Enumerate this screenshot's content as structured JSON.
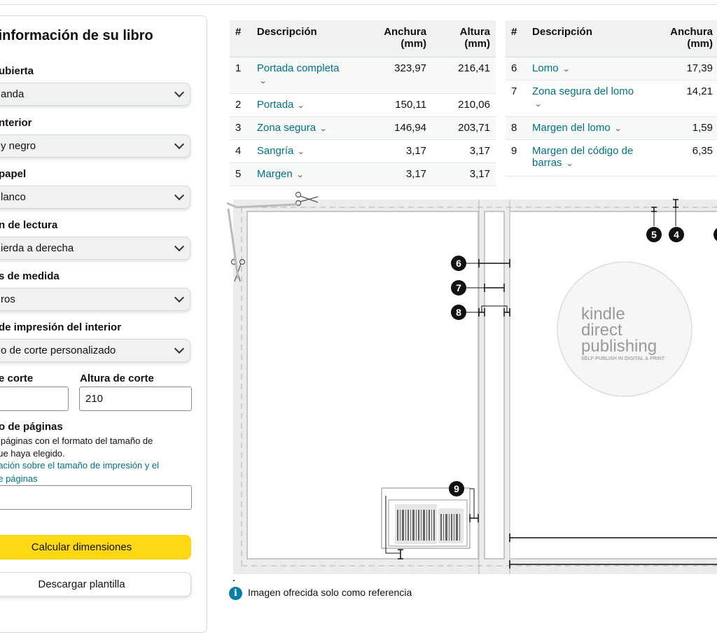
{
  "form": {
    "title": "r la información de su libro",
    "cover_label": "ubierta",
    "cover_value": "anda",
    "interior_label": "nterior",
    "interior_value": "y negro",
    "paper_label": "papel",
    "paper_value": "lanco",
    "reading_label": "n de lectura",
    "reading_value": "ierda a derecha",
    "units_label": "s de medida",
    "units_value": "ros",
    "trim_label": "de impresión del interior",
    "trim_value": "o de corte personalizado",
    "width_label": "e corte",
    "height_label": "Altura de corte",
    "width_value": "",
    "height_value": "210",
    "pages_label": "o de páginas",
    "pages_hint_1": "e páginas con el formato del tamaño de",
    "pages_hint_2": "que haya elegido.",
    "pages_link_1": "nación sobre el tamaño de impresión y el",
    "pages_link_2": "de páginas",
    "pages_value": "",
    "calc_button": "Calcular dimensiones",
    "download_button": "Descargar plantilla"
  },
  "table_headers": {
    "num": "#",
    "desc": "Descripción",
    "width": "Anchura (mm)",
    "height": "Altura (mm)"
  },
  "table1": [
    {
      "n": "1",
      "desc": "Portada completa",
      "w": "323,97",
      "h": "216,41"
    },
    {
      "n": "2",
      "desc": "Portada",
      "w": "150,11",
      "h": "210,06"
    },
    {
      "n": "3",
      "desc": "Zona segura",
      "w": "146,94",
      "h": "203,71"
    },
    {
      "n": "4",
      "desc": "Sangría",
      "w": "3,17",
      "h": "3,17"
    },
    {
      "n": "5",
      "desc": "Margen",
      "w": "3,17",
      "h": "3,17"
    }
  ],
  "table2": [
    {
      "n": "6",
      "desc": "Lomo",
      "w": "17,39"
    },
    {
      "n": "7",
      "desc": "Zona segura del lomo",
      "w": "14,21"
    },
    {
      "n": "8",
      "desc": "Margen del lomo",
      "w": "1,59"
    },
    {
      "n": "9",
      "desc": "Margen del código de barras",
      "w": "6,35"
    }
  ],
  "diagram": {
    "markers": [
      "4",
      "5",
      "6",
      "7",
      "8",
      "9"
    ],
    "logo_line1": "kindle",
    "logo_line2": "direct",
    "logo_line3": "publishing",
    "logo_tagline": "SELF-PUBLISH IN DIGITAL & PRINT"
  },
  "note": "Imagen ofrecida solo como referencia",
  "icons": {
    "chevron": "chevron-down-icon",
    "scissors": "scissors-icon",
    "info": "info-icon"
  }
}
